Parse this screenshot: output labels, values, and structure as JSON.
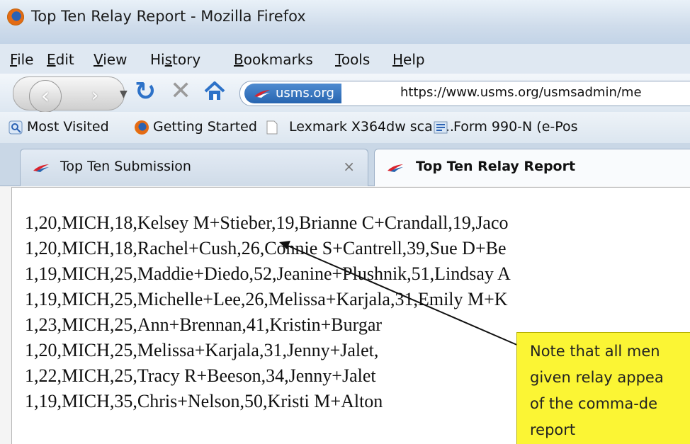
{
  "window": {
    "title": "Top Ten Relay Report - Mozilla Firefox"
  },
  "menu": [
    {
      "pre": "",
      "u": "F",
      "post": "ile"
    },
    {
      "pre": "",
      "u": "E",
      "post": "dit"
    },
    {
      "pre": "",
      "u": "V",
      "post": "iew"
    },
    {
      "pre": "Hi",
      "u": "s",
      "post": "tory"
    },
    {
      "pre": "",
      "u": "B",
      "post": "ookmarks"
    },
    {
      "pre": "",
      "u": "T",
      "post": "ools"
    },
    {
      "pre": "",
      "u": "H",
      "post": "elp"
    }
  ],
  "nav": {
    "site_badge": "usms.org",
    "url": "https://www.usms.org/usmsadmin/me"
  },
  "bookmarks": [
    {
      "label": "Most Visited",
      "icon": "most-visited-icon"
    },
    {
      "label": "Getting Started",
      "icon": "firefox-icon"
    },
    {
      "label": "Lexmark X364dw scan...",
      "icon": "page-icon"
    },
    {
      "label": "Form 990-N (e-Pos",
      "icon": "irs-icon"
    }
  ],
  "tabs": [
    {
      "label": "Top Ten Submission",
      "close": "×"
    },
    {
      "label": "Top Ten Relay Report"
    }
  ],
  "report_lines": [
    "1,20,MICH,18,Kelsey M+Stieber,19,Brianne C+Crandall,19,Jaco",
    "1,20,MICH,18,Rachel+Cush,26,Connie S+Cantrell,39,Sue D+Be",
    "1,19,MICH,25,Maddie+Diedo,52,Jeanine+Plushnik,51,Lindsay A",
    "1,19,MICH,25,Michelle+Lee,26,Melissa+Karjala,31,Emily M+K",
    "1,23,MICH,25,Ann+Brennan,41,Kristin+Burgar",
    "1,20,MICH,25,Melissa+Karjala,31,Jenny+Jalet,",
    "1,22,MICH,25,Tracy R+Beeson,34,Jenny+Jalet",
    "1,19,MICH,35,Chris+Nelson,50,Kristi M+Alton"
  ],
  "callout": {
    "lines": [
      "Note that all men",
      "given relay appea",
      "of the comma-de",
      "report"
    ]
  },
  "colors": {
    "callout_bg": "#fbf534",
    "arrow": "#111111"
  }
}
